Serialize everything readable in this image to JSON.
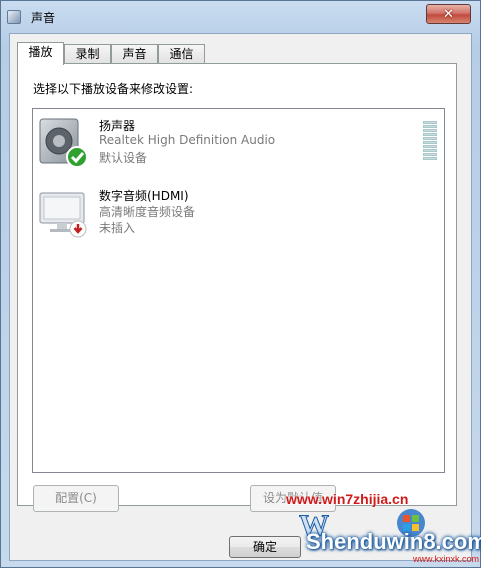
{
  "window": {
    "title": "声音"
  },
  "tabs": [
    {
      "label": "播放",
      "active": true
    },
    {
      "label": "录制",
      "active": false
    },
    {
      "label": "声音",
      "active": false
    },
    {
      "label": "通信",
      "active": false
    }
  ],
  "playback": {
    "instruction": "选择以下播放设备来修改设置:",
    "devices": [
      {
        "name": "扬声器",
        "description": "Realtek High Definition Audio",
        "status": "默认设备",
        "icon": "speaker-icon",
        "badge": "default-check-icon"
      },
      {
        "name": "数字音频(HDMI)",
        "description": "高清晰度音频设备",
        "status": "未插入",
        "icon": "hdmi-monitor-icon",
        "badge": "unplugged-icon"
      }
    ]
  },
  "buttons": {
    "configure": "配置(C)",
    "set_default": "设为默认值",
    "ok": "确定"
  },
  "watermark": {
    "url": "www.win7zhijia.cn",
    "site": "Shenduwin8.com",
    "small": "www.kxinxk.com"
  },
  "colors": {
    "close_button": "#c14a3e",
    "default_badge": "#2fa12f",
    "unplugged_badge": "#c02020"
  }
}
